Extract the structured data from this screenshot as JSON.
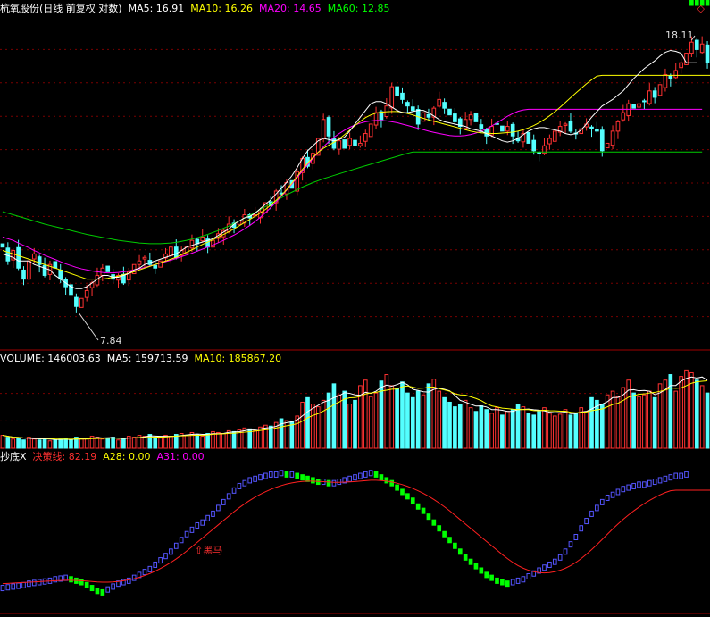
{
  "colors": {
    "background": "#000000",
    "up": "#ff3232",
    "down": "#54ffff",
    "ma5": "#ffffff",
    "ma10": "#ffff00",
    "ma20": "#ff00ff",
    "ma60": "#00cc00",
    "grid": "#7a0000",
    "panel_border": "#a00000",
    "indicator_rise": "#5555ff",
    "indicator_fall": "#00ff00",
    "decision_line": "#ff2020"
  },
  "price_panel": {
    "stock_title": "杭氧股份(日线 前复权 对数)",
    "ma5_label": "MA5: 16.91",
    "ma10_label": "MA10: 16.26",
    "ma20_label": "MA20: 14.65",
    "ma60_label": "MA60: 12.85",
    "corner_icon": "diamond-icon",
    "corner_glyph": "◇",
    "high_marker": "18.11",
    "low_marker": "7.84",
    "high_value": 18.11,
    "low_value": 7.84
  },
  "volume_panel": {
    "volume_label": "VOLUME: 146003.63",
    "ma5_label": "MA5: 159713.59",
    "ma10_label": "MA10: 185867.20"
  },
  "indicator_panel": {
    "name": "抄底X",
    "decision_label": "决策线: 82.19",
    "a28_label": "A28: 0.00",
    "a31_label": "A31: 0.00",
    "signal_label": "黑马",
    "signal_icon": "up-arrow-icon"
  },
  "chart_data": {
    "type": "candlestick",
    "scale": "log",
    "y_range": [
      7.0,
      19.5
    ],
    "grid": true,
    "series": {
      "close": [
        9.6,
        9.2,
        9.5,
        9.0,
        8.7,
        9.2,
        9.4,
        9.1,
        8.8,
        9.1,
        9.0,
        8.7,
        8.5,
        8.3,
        8.0,
        8.2,
        8.4,
        8.6,
        8.8,
        9.0,
        8.9,
        8.7,
        8.8,
        8.6,
        8.9,
        9.1,
        9.2,
        9.3,
        9.1,
        9.0,
        9.2,
        9.4,
        9.6,
        9.3,
        9.5,
        9.6,
        9.8,
        9.7,
        9.9,
        9.6,
        9.8,
        10.0,
        10.1,
        10.3,
        10.2,
        10.4,
        10.6,
        10.5,
        10.6,
        10.7,
        11.0,
        10.9,
        11.4,
        11.3,
        11.7,
        11.5,
        12.1,
        12.6,
        12.3,
        12.8,
        13.4,
        14.2,
        13.5,
        13.0,
        13.3,
        13.0,
        13.4,
        13.1,
        13.2,
        13.6,
        14.0,
        14.5,
        14.2,
        14.8,
        15.7,
        15.3,
        15.1,
        14.8,
        14.6,
        14.0,
        14.5,
        14.3,
        14.7,
        15.1,
        14.7,
        14.4,
        14.1,
        13.9,
        14.2,
        14.4,
        14.1,
        13.8,
        13.5,
        13.9,
        14.0,
        13.7,
        13.9,
        13.5,
        13.3,
        13.6,
        13.2,
        12.9,
        12.8,
        13.1,
        13.4,
        13.7,
        13.9,
        14.0,
        13.7,
        13.6,
        13.8,
        14.0,
        13.8,
        13.7,
        12.9,
        13.2,
        13.7,
        14.1,
        14.5,
        14.9,
        14.7,
        14.9,
        15.0,
        15.5,
        15.2,
        15.8,
        16.3,
        16.1,
        16.5,
        16.9,
        17.4,
        18.0,
        17.6,
        17.9,
        16.9
      ],
      "ma5": [
        9.4,
        9.35,
        9.3,
        9.2,
        9.2,
        9.2,
        9.1,
        9.05,
        9.0,
        8.95,
        8.8,
        8.7,
        8.6,
        8.5,
        8.45,
        8.45,
        8.5,
        8.6,
        8.7,
        8.8,
        8.8,
        8.75,
        8.75,
        8.8,
        8.85,
        8.95,
        9.0,
        9.1,
        9.15,
        9.2,
        9.25,
        9.3,
        9.35,
        9.4,
        9.5,
        9.6,
        9.65,
        9.7,
        9.75,
        9.8,
        9.85,
        9.95,
        10.05,
        10.15,
        10.3,
        10.4,
        10.5,
        10.55,
        10.65,
        10.8,
        10.95,
        11.1,
        11.3,
        11.5,
        11.7,
        11.95,
        12.25,
        12.6,
        12.9,
        13.1,
        13.3,
        13.4,
        13.35,
        13.3,
        13.35,
        13.45,
        13.7,
        14.0,
        14.3,
        14.6,
        14.9,
        15.0,
        15.0,
        14.9,
        14.75,
        14.6,
        14.5,
        14.5,
        14.55,
        14.6,
        14.6,
        14.5,
        14.35,
        14.2,
        14.1,
        14.05,
        14.0,
        13.95,
        13.9,
        13.8,
        13.75,
        13.7,
        13.6,
        13.5,
        13.4,
        13.3,
        13.25,
        13.3,
        13.4,
        13.55,
        13.7,
        13.8,
        13.85,
        13.85,
        13.8,
        13.75,
        13.7,
        13.6,
        13.55,
        13.6,
        13.75,
        14.0,
        14.3,
        14.55,
        14.8,
        14.95,
        15.1,
        15.3,
        15.5,
        15.8,
        16.1,
        16.35,
        16.6,
        16.8,
        17.0,
        17.25,
        17.45,
        17.55,
        17.5,
        17.4,
        16.9,
        16.9,
        16.9
      ],
      "ma10": [
        9.5,
        9.45,
        9.4,
        9.35,
        9.3,
        9.25,
        9.2,
        9.15,
        9.1,
        9.05,
        9.0,
        8.95,
        8.9,
        8.85,
        8.8,
        8.75,
        8.7,
        8.7,
        8.7,
        8.7,
        8.72,
        8.75,
        8.78,
        8.82,
        8.86,
        8.9,
        8.95,
        9.0,
        9.05,
        9.1,
        9.15,
        9.2,
        9.25,
        9.3,
        9.38,
        9.45,
        9.52,
        9.6,
        9.68,
        9.75,
        9.82,
        9.9,
        9.98,
        10.06,
        10.15,
        10.25,
        10.35,
        10.45,
        10.55,
        10.66,
        10.78,
        10.92,
        11.08,
        11.25,
        11.45,
        11.68,
        11.92,
        12.18,
        12.42,
        12.64,
        12.84,
        13.0,
        13.12,
        13.24,
        13.38,
        13.55,
        13.74,
        13.94,
        14.12,
        14.28,
        14.4,
        14.48,
        14.52,
        14.54,
        14.55,
        14.55,
        14.52,
        14.46,
        14.4,
        14.32,
        14.25,
        14.18,
        14.12,
        14.06,
        14.0,
        13.94,
        13.88,
        13.82,
        13.76,
        13.7,
        13.66,
        13.63,
        13.61,
        13.6,
        13.6,
        13.62,
        13.64,
        13.66,
        13.7,
        13.76,
        13.84,
        13.94,
        14.06,
        14.2,
        14.36,
        14.54,
        14.74,
        14.96,
        15.18,
        15.4,
        15.62,
        15.84,
        16.04,
        16.22,
        16.26,
        16.26,
        16.26,
        16.26,
        16.26,
        16.26,
        16.26,
        16.26,
        16.26,
        16.26,
        16.26,
        16.26,
        16.26,
        16.26,
        16.26,
        16.26,
        16.26,
        16.26,
        16.26,
        16.26,
        16.26,
        16.26
      ],
      "ma20": [
        9.9,
        9.85,
        9.8,
        9.72,
        9.65,
        9.58,
        9.5,
        9.43,
        9.36,
        9.3,
        9.24,
        9.18,
        9.12,
        9.07,
        9.02,
        8.98,
        8.95,
        8.92,
        8.9,
        8.88,
        8.87,
        8.87,
        8.88,
        8.9,
        8.92,
        8.95,
        8.98,
        9.02,
        9.06,
        9.1,
        9.14,
        9.18,
        9.22,
        9.27,
        9.32,
        9.37,
        9.42,
        9.48,
        9.54,
        9.6,
        9.66,
        9.73,
        9.8,
        9.88,
        9.96,
        10.05,
        10.15,
        10.26,
        10.38,
        10.52,
        10.67,
        10.84,
        11.02,
        11.22,
        11.43,
        11.65,
        11.88,
        12.12,
        12.36,
        12.6,
        12.84,
        13.06,
        13.26,
        13.44,
        13.6,
        13.74,
        13.86,
        13.96,
        14.04,
        14.1,
        14.14,
        14.16,
        14.16,
        14.14,
        14.1,
        14.06,
        14.0,
        13.94,
        13.88,
        13.82,
        13.76,
        13.7,
        13.65,
        13.6,
        13.56,
        13.52,
        13.5,
        13.5,
        13.52,
        13.56,
        13.62,
        13.7,
        13.8,
        13.92,
        14.06,
        14.2,
        14.34,
        14.46,
        14.56,
        14.62,
        14.65,
        14.65,
        14.65,
        14.65,
        14.65,
        14.65,
        14.65,
        14.65,
        14.65,
        14.65,
        14.65,
        14.65,
        14.65,
        14.65,
        14.65,
        14.65,
        14.65,
        14.65,
        14.65,
        14.65,
        14.65,
        14.65,
        14.65,
        14.65,
        14.65,
        14.65,
        14.65,
        14.65,
        14.65,
        14.65,
        14.65,
        14.65,
        14.65,
        14.65
      ],
      "ma60": [
        10.7,
        10.65,
        10.6,
        10.55,
        10.5,
        10.45,
        10.4,
        10.35,
        10.3,
        10.26,
        10.22,
        10.18,
        10.14,
        10.1,
        10.06,
        10.02,
        9.98,
        9.95,
        9.92,
        9.89,
        9.86,
        9.83,
        9.8,
        9.78,
        9.76,
        9.74,
        9.72,
        9.71,
        9.7,
        9.7,
        9.7,
        9.71,
        9.72,
        9.74,
        9.77,
        9.8,
        9.84,
        9.88,
        9.93,
        9.98,
        10.04,
        10.1,
        10.17,
        10.24,
        10.32,
        10.4,
        10.49,
        10.58,
        10.67,
        10.77,
        10.87,
        10.97,
        11.07,
        11.17,
        11.27,
        11.36,
        11.45,
        11.54,
        11.62,
        11.7,
        11.77,
        11.84,
        11.9,
        11.96,
        12.02,
        12.08,
        12.14,
        12.2,
        12.26,
        12.32,
        12.38,
        12.44,
        12.5,
        12.56,
        12.62,
        12.68,
        12.74,
        12.8,
        12.85,
        12.85,
        12.85,
        12.85,
        12.85,
        12.85,
        12.85,
        12.85,
        12.85,
        12.85,
        12.85,
        12.85,
        12.85,
        12.85,
        12.85,
        12.85,
        12.85,
        12.85,
        12.85,
        12.85,
        12.85,
        12.85,
        12.85,
        12.85,
        12.85,
        12.85,
        12.85,
        12.85,
        12.85,
        12.85,
        12.85,
        12.85,
        12.85,
        12.85,
        12.85,
        12.85,
        12.85,
        12.85,
        12.85,
        12.85,
        12.85,
        12.85,
        12.85,
        12.85,
        12.85,
        12.85,
        12.85,
        12.85,
        12.85,
        12.85,
        12.85,
        12.85,
        12.85,
        12.85,
        12.85,
        12.85
      ],
      "volume": [
        14,
        12,
        10,
        11,
        9,
        12,
        10,
        9,
        11,
        8,
        9,
        10,
        11,
        9,
        12,
        10,
        11,
        13,
        12,
        10,
        11,
        12,
        9,
        10,
        13,
        12,
        14,
        13,
        15,
        12,
        11,
        14,
        13,
        15,
        16,
        14,
        17,
        15,
        13,
        16,
        18,
        17,
        16,
        19,
        18,
        20,
        22,
        21,
        19,
        23,
        25,
        24,
        28,
        32,
        30,
        29,
        35,
        50,
        55,
        48,
        45,
        52,
        60,
        70,
        58,
        62,
        48,
        52,
        68,
        74,
        56,
        60,
        73,
        80,
        68,
        65,
        72,
        60,
        55,
        62,
        58,
        70,
        75,
        62,
        55,
        50,
        45,
        48,
        52,
        44,
        40,
        46,
        42,
        38,
        44,
        36,
        40,
        42,
        48,
        45,
        38,
        36,
        40,
        44,
        38,
        35,
        37,
        42,
        36,
        38,
        44,
        40,
        55,
        52,
        48,
        58,
        62,
        56,
        66,
        74,
        60,
        56,
        58,
        62,
        55,
        70,
        74,
        80,
        62,
        78,
        85,
        82,
        74,
        68,
        60
      ],
      "indicator": [
        15,
        15.5,
        16,
        16.5,
        17,
        18,
        18.5,
        19,
        19.5,
        20,
        21,
        21.5,
        22,
        21,
        20,
        19,
        17,
        15,
        13,
        12,
        14,
        16,
        18,
        19,
        20,
        22,
        24,
        26,
        28,
        31,
        34,
        37,
        40,
        44,
        48,
        52,
        55,
        58,
        60,
        63,
        66,
        70,
        74,
        78,
        82,
        85,
        87,
        89,
        90,
        91,
        92,
        93,
        93,
        94,
        93,
        93,
        92,
        91,
        90,
        89,
        88,
        88,
        87,
        87,
        88,
        89,
        90,
        91,
        92,
        93,
        94,
        93,
        91,
        89,
        87,
        84,
        81,
        78,
        75,
        71,
        68,
        64,
        60,
        56,
        52,
        48,
        44,
        40,
        36,
        33,
        30,
        27,
        24,
        22,
        20,
        19,
        18,
        19,
        20,
        21,
        23,
        25,
        27,
        29,
        31,
        33,
        36,
        40,
        45,
        50,
        56,
        61,
        66,
        70,
        74,
        77,
        79,
        81,
        83,
        84,
        85,
        86,
        86,
        87,
        88,
        89,
        90,
        91,
        92,
        92,
        93
      ],
      "decision": [
        18,
        18.2,
        18.4,
        18.6,
        18.8,
        19,
        19.2,
        19.4,
        19.6,
        19.8,
        20,
        20.2,
        20.3,
        20.3,
        20.2,
        20,
        19.8,
        19.5,
        19.2,
        19,
        19,
        19.2,
        19.5,
        20,
        20.6,
        21.4,
        22.4,
        23.6,
        25,
        26.6,
        28.4,
        30.4,
        32.6,
        35,
        37.6,
        40.4,
        43.4,
        46.4,
        49.4,
        52.4,
        55.4,
        58.4,
        61.4,
        64.4,
        67.4,
        70.2,
        72.8,
        75.2,
        77.4,
        79.4,
        81.2,
        82.8,
        84.2,
        85.4,
        86.4,
        87.2,
        87.8,
        88.2,
        88.4,
        88.4,
        88.2,
        88,
        87.8,
        87.6,
        87.6,
        87.7,
        87.9,
        88.1,
        88.4,
        88.7,
        89,
        89,
        88.8,
        88.4,
        87.8,
        87,
        86,
        84.8,
        83.4,
        81.8,
        80,
        78,
        75.8,
        73.4,
        70.8,
        68,
        65,
        62,
        59,
        56,
        53,
        50,
        47,
        44,
        41,
        38,
        35.2,
        32.6,
        30.4,
        28.6,
        27.2,
        26.2,
        25.6,
        25.4,
        25.6,
        26.2,
        27.2,
        28.6,
        30.4,
        32.6,
        35.2,
        38.2,
        41.4,
        44.8,
        48.4,
        52,
        55.6,
        59,
        62.2,
        65.2,
        68,
        70.6,
        73,
        75.2,
        77.2,
        79,
        80.6,
        81.8,
        82.19,
        82.19,
        82.19,
        82.19,
        82.19,
        82.19,
        82.19,
        82.19,
        82.19,
        82.19
      ]
    }
  }
}
